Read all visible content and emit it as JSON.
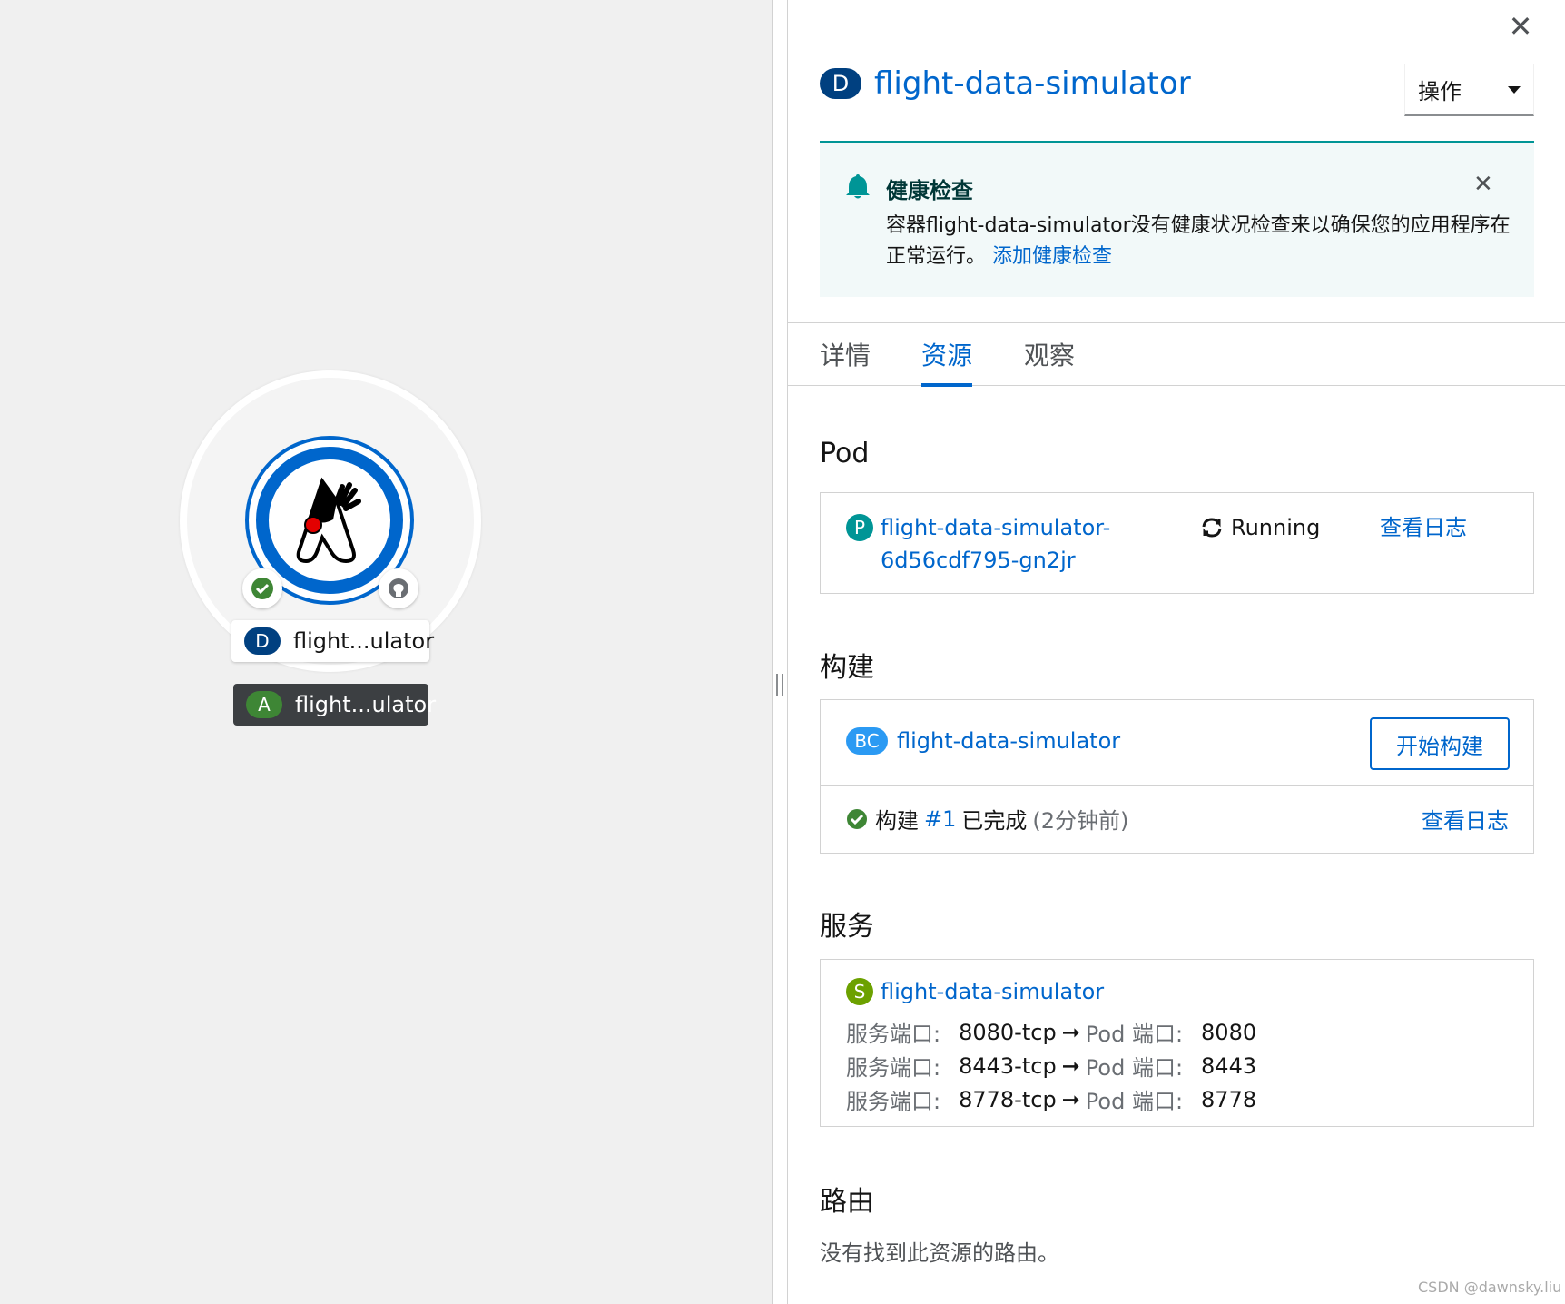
{
  "topology": {
    "deployment_badge": "D",
    "deployment_label": "flight...ulator",
    "app_badge": "A",
    "app_label": "flight...ulator"
  },
  "panel": {
    "resource_badge": "D",
    "resource_name": "flight-data-simulator",
    "actions_label": "操作",
    "alert": {
      "title": "健康检查",
      "body": "容器flight-data-simulator没有健康状况检查来以确保您的应用程序在正常运行。",
      "link": "添加健康检查"
    },
    "tabs": [
      {
        "label": "详情"
      },
      {
        "label": "资源"
      },
      {
        "label": "观察"
      }
    ],
    "pod": {
      "section_title": "Pod",
      "badge": "P",
      "name_line1": "flight-data-simulator-",
      "name_line2": "6d56cdf795-gn2jr",
      "status": "Running",
      "logs_link": "查看日志"
    },
    "build": {
      "section_title": "构建",
      "badge": "BC",
      "config_name": "flight-data-simulator",
      "start_button": "开始构建",
      "status_prefix": "构建",
      "build_number": "#1",
      "status_text": "已完成",
      "time_ago": "(2分钟前)",
      "logs_link": "查看日志"
    },
    "service": {
      "section_title": "服务",
      "badge": "S",
      "name": "flight-data-simulator",
      "service_port_label": "服务端口:",
      "pod_port_label": "Pod 端口:",
      "ports": [
        {
          "service_port": "8080-tcp",
          "pod_port": "8080"
        },
        {
          "service_port": "8443-tcp",
          "pod_port": "8443"
        },
        {
          "service_port": "8778-tcp",
          "pod_port": "8778"
        }
      ]
    },
    "routes": {
      "section_title": "路由",
      "empty_text": "没有找到此资源的路由。"
    }
  },
  "watermark": "CSDN @dawnsky.liu",
  "colors": {
    "link": "#0066cc",
    "deployment_badge": "#004080",
    "pod_badge": "#009596",
    "build_badge": "#2b9af3",
    "service_badge": "#6ca100",
    "app_badge": "#3e8635",
    "alert_bg": "#f2f9f9",
    "success": "#3e8635"
  }
}
